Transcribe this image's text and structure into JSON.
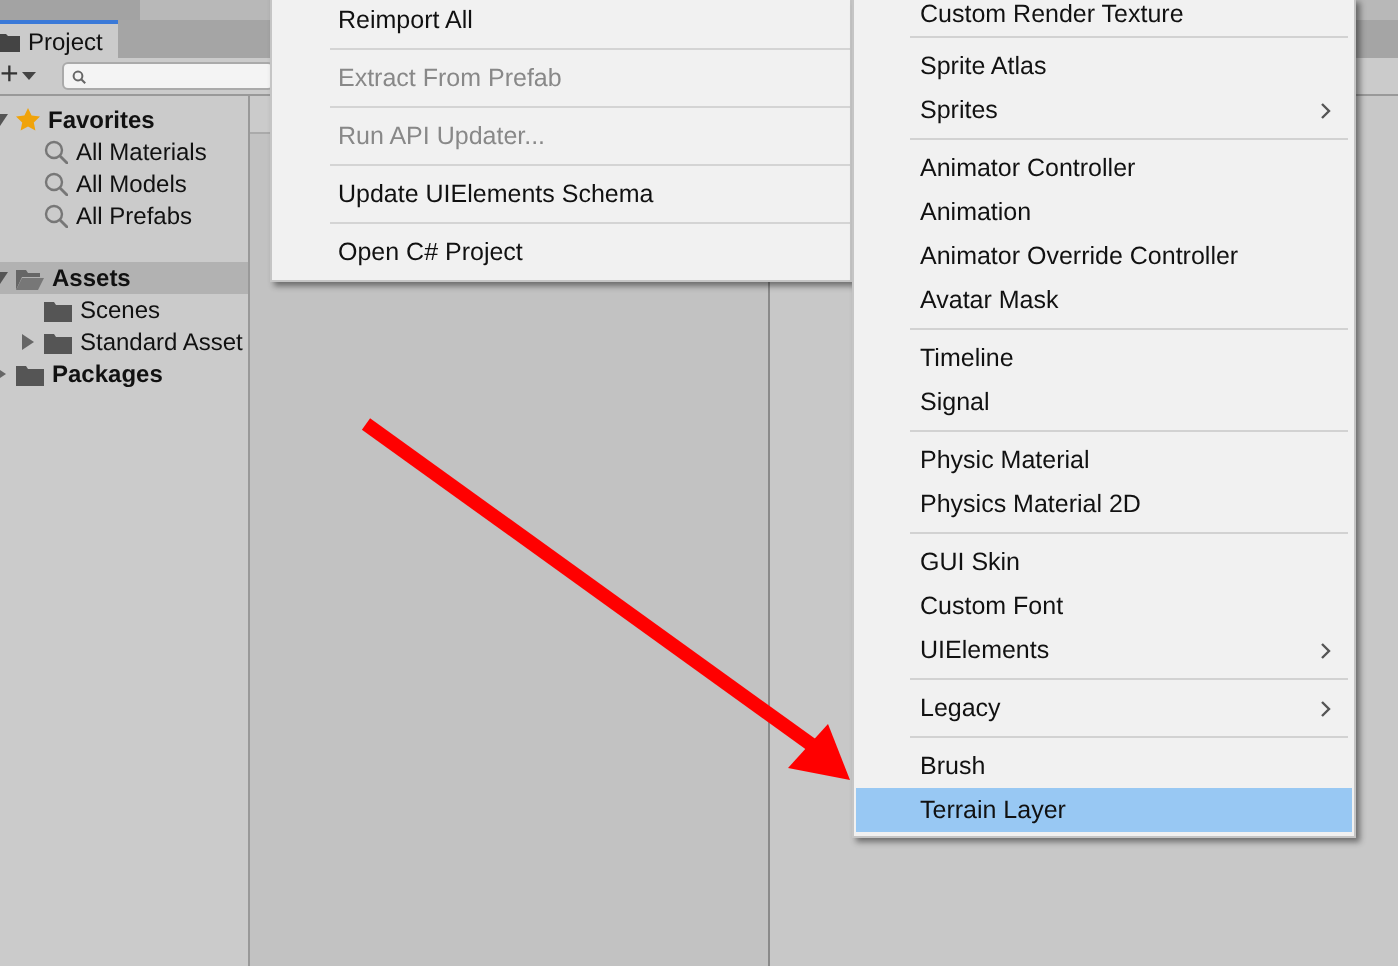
{
  "project_panel": {
    "tab": {
      "label": "Project",
      "selected": true
    },
    "add_button": "+",
    "tree": [
      {
        "label": "Favorites",
        "kind": "star",
        "expanded": true,
        "selected": false,
        "children": [
          {
            "label": "All Materials",
            "kind": "search",
            "selected": false
          },
          {
            "label": "All Models",
            "kind": "search",
            "selected": false
          },
          {
            "label": "All Prefabs",
            "kind": "search",
            "selected": false
          }
        ]
      },
      {
        "label": "Assets",
        "kind": "folder-open",
        "expanded": true,
        "selected": true,
        "children": [
          {
            "label": "Scenes",
            "kind": "folder",
            "selected": false
          },
          {
            "label": "Standard Asset",
            "kind": "folder",
            "expanded": false,
            "selected": false
          }
        ]
      },
      {
        "label": "Packages",
        "kind": "folder",
        "expanded": false,
        "selected": false
      }
    ]
  },
  "context_menu": {
    "groups": [
      [
        {
          "label": "Reimport All",
          "disabled": false
        }
      ],
      [
        {
          "label": "Extract From Prefab",
          "disabled": true
        }
      ],
      [
        {
          "label": "Run API Updater...",
          "disabled": true
        }
      ],
      [
        {
          "label": "Update UIElements Schema",
          "disabled": false
        }
      ],
      [
        {
          "label": "Open C# Project",
          "disabled": false
        }
      ]
    ]
  },
  "create_submenu": {
    "groups": [
      [
        {
          "label": "Custom Render Texture",
          "submenu": false,
          "selected": false
        }
      ],
      [
        {
          "label": "Sprite Atlas",
          "submenu": false,
          "selected": false
        },
        {
          "label": "Sprites",
          "submenu": true,
          "selected": false
        }
      ],
      [
        {
          "label": "Animator Controller",
          "submenu": false,
          "selected": false
        },
        {
          "label": "Animation",
          "submenu": false,
          "selected": false
        },
        {
          "label": "Animator Override Controller",
          "submenu": false,
          "selected": false
        },
        {
          "label": "Avatar Mask",
          "submenu": false,
          "selected": false
        }
      ],
      [
        {
          "label": "Timeline",
          "submenu": false,
          "selected": false
        },
        {
          "label": "Signal",
          "submenu": false,
          "selected": false
        }
      ],
      [
        {
          "label": "Physic Material",
          "submenu": false,
          "selected": false
        },
        {
          "label": "Physics Material 2D",
          "submenu": false,
          "selected": false
        }
      ],
      [
        {
          "label": "GUI Skin",
          "submenu": false,
          "selected": false
        },
        {
          "label": "Custom Font",
          "submenu": false,
          "selected": false
        },
        {
          "label": "UIElements",
          "submenu": true,
          "selected": false
        }
      ],
      [
        {
          "label": "Legacy",
          "submenu": true,
          "selected": false
        }
      ],
      [
        {
          "label": "Brush",
          "submenu": false,
          "selected": false
        },
        {
          "label": "Terrain Layer",
          "submenu": false,
          "selected": true
        }
      ]
    ]
  }
}
